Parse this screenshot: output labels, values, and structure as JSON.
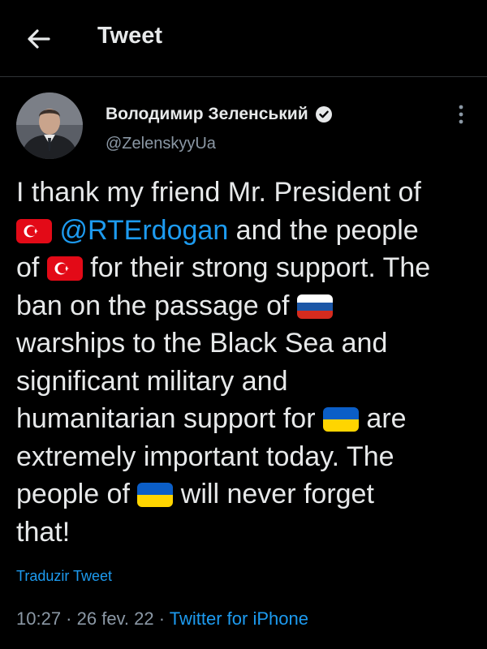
{
  "header": {
    "title": "Tweet"
  },
  "author": {
    "name": "Володимир Зеленський",
    "handle": "@ZelenskyyUa"
  },
  "tweet": {
    "line1": "I thank my friend Mr. President of",
    "mention": "@RTErdogan",
    "line2_after": " and the people",
    "line3_before": "of ",
    "line3_after": " for their strong support. The",
    "line4": "ban on the passage of ",
    "line5": "warships to the Black Sea and",
    "line6": "significant military and",
    "line7_before": "humanitarian support for ",
    "line7_after": " are",
    "line8": "extremely important today. The",
    "line9_before": "people of ",
    "line9_after": " will never forget",
    "line10": "that!"
  },
  "translate_link": "Traduzir Tweet",
  "meta": {
    "time": "10:27",
    "sep": " · ",
    "date": "26 fev. 22",
    "source": "Twitter for iPhone"
  },
  "colors": {
    "background": "#000000",
    "text": "#e7e9ea",
    "link": "#1d9bf0",
    "muted": "#8b98a5"
  },
  "flags": [
    "turkey-flag",
    "russia-flag",
    "ukraine-flag"
  ]
}
